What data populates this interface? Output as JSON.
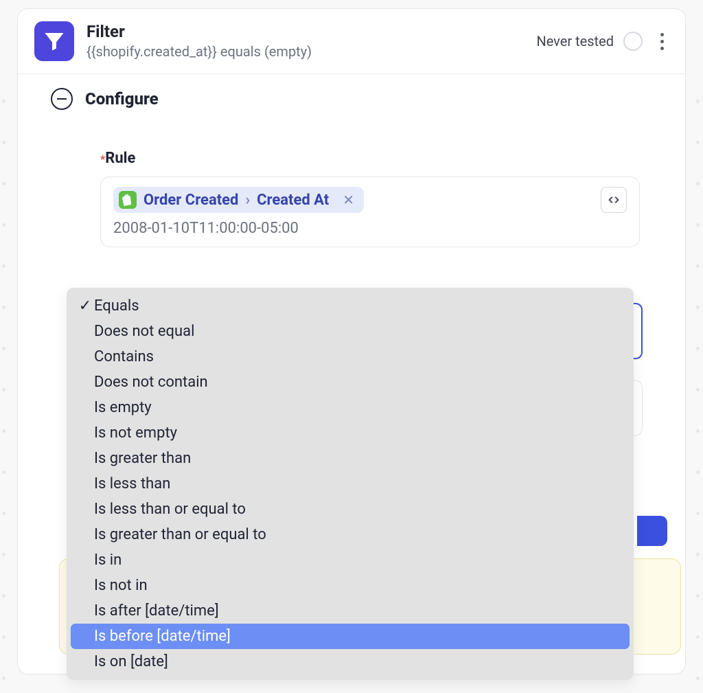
{
  "header": {
    "title": "Filter",
    "subtitle": "{{shopify.created_at}} equals (empty)",
    "status": "Never tested"
  },
  "configure": {
    "section_title": "Configure",
    "rule_label": "Rule",
    "chip": {
      "source": "Order Created",
      "field": "Created At"
    },
    "value": "2008-01-10T11:00:00-05:00"
  },
  "dropdown": {
    "selected_index": 0,
    "highlight_index": 13,
    "options": [
      "Equals",
      "Does not equal",
      "Contains",
      "Does not contain",
      "Is empty",
      "Is not empty",
      "Is greater than",
      "Is less than",
      "Is less than or equal to",
      "Is greater than or equal to",
      "Is in",
      "Is not in",
      "Is after [date/time]",
      "Is before [date/time]",
      "Is on [date]"
    ]
  }
}
